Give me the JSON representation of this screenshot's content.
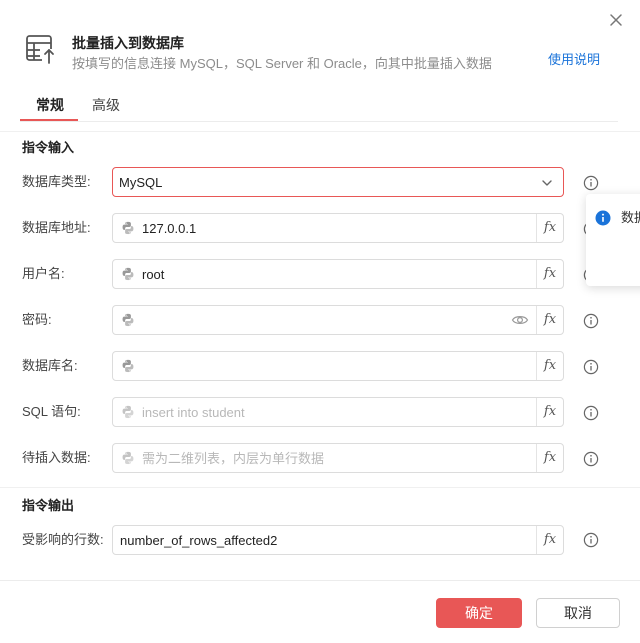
{
  "header": {
    "title": "批量插入到数据库",
    "description": "按填写的信息连接 MySQL，SQL Server 和 Oracle，向其中批量插入数据",
    "help_link": "使用说明"
  },
  "tabs": [
    {
      "label": "常规",
      "active": true
    },
    {
      "label": "高级",
      "active": false
    }
  ],
  "input_section": {
    "title": "指令输入",
    "fields": [
      {
        "label": "数据库类型:",
        "type": "select",
        "value": "MySQL"
      },
      {
        "label": "数据库地址:",
        "type": "text",
        "value": "127.0.0.1",
        "placeholder": ""
      },
      {
        "label": "用户名:",
        "type": "text",
        "value": "root",
        "placeholder": ""
      },
      {
        "label": "密码:",
        "type": "password",
        "value": "",
        "placeholder": ""
      },
      {
        "label": "数据库名:",
        "type": "text",
        "value": "",
        "placeholder": ""
      },
      {
        "label": "SQL 语句:",
        "type": "text",
        "value": "",
        "placeholder": "insert into student"
      },
      {
        "label": "待插入数据:",
        "type": "text",
        "value": "",
        "placeholder": "需为二维列表，内层为单行数据"
      }
    ]
  },
  "output_section": {
    "title": "指令输出",
    "fields": [
      {
        "label": "受影响的行数:",
        "value": "number_of_rows_affected2"
      }
    ]
  },
  "fx_label": "fx",
  "tooltip": {
    "text": "数据"
  },
  "footer": {
    "ok_label": "确定",
    "cancel_label": "取消"
  },
  "colors": {
    "accent": "#e85756",
    "link": "#1a73d9",
    "info": "#1a73d9"
  },
  "icons": {
    "close": "close-icon",
    "header": "table-insert-icon",
    "python": "python-icon",
    "function": "fx-icon",
    "info": "info-icon",
    "eye": "eye-icon",
    "chevron": "chevron-down-icon"
  }
}
